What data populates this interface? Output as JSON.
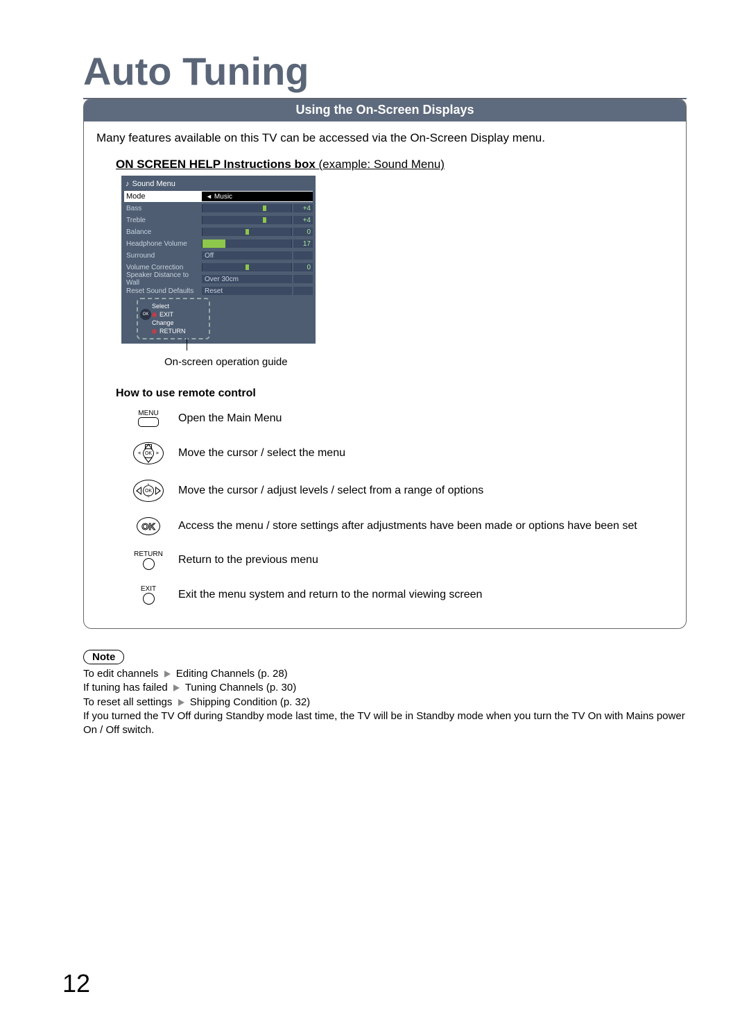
{
  "page": {
    "title": "Auto Tuning",
    "number": "12"
  },
  "panel": {
    "header": "Using the On-Screen Displays",
    "intro": "Many features available on this TV can be accessed via the On-Screen Display menu.",
    "helpbox_title_bold": "ON SCREEN HELP Instructions box",
    "helpbox_title_rest": " (example: Sound Menu)",
    "osd": {
      "title": "Sound Menu",
      "mode_label": "Mode",
      "mode_value": "Music",
      "rows": [
        {
          "label": "Bass",
          "value": "+4"
        },
        {
          "label": "Treble",
          "value": "+4"
        },
        {
          "label": "Balance",
          "value": "0"
        },
        {
          "label": "Headphone Volume",
          "value": "17"
        },
        {
          "label": "Surround",
          "text": "Off"
        },
        {
          "label": "Volume Correction",
          "value": "0"
        },
        {
          "label": "Speaker Distance to Wall",
          "text": "Over 30cm"
        },
        {
          "label": "Reset Sound Defaults",
          "text": "Reset"
        }
      ],
      "callout": {
        "select": "Select",
        "exit": "EXIT",
        "change": "Change",
        "return": "RETURN",
        "ok": "OK"
      },
      "caption": "On-screen operation guide"
    },
    "remote": {
      "heading": "How to use remote control",
      "items": [
        {
          "icon_label": "MENU",
          "desc": "Open the Main Menu"
        },
        {
          "icon_label": "",
          "desc": "Move the cursor / select the menu"
        },
        {
          "icon_label": "",
          "desc": "Move the cursor / adjust levels / select from a range of options"
        },
        {
          "icon_label": "",
          "desc": "Access the menu / store settings after adjustments have been made or options have been set",
          "ok": "OK"
        },
        {
          "icon_label": "RETURN",
          "desc": "Return to the previous menu"
        },
        {
          "icon_label": "EXIT",
          "desc": "Exit the menu system and return to the normal viewing screen"
        }
      ]
    }
  },
  "note": {
    "badge": "Note",
    "lines": {
      "l1a": "To edit channels ",
      "l1b": " Editing Channels  (p. 28)",
      "l2a": "If tuning has failed ",
      "l2b": " Tuning Channels  (p. 30)",
      "l3a": "To reset all settings ",
      "l3b": " Shipping Condition  (p. 32)",
      "l4": "If you turned the TV Off during Standby mode last time, the TV will be in Standby mode when you turn the TV On with Mains power On / Off switch."
    }
  }
}
